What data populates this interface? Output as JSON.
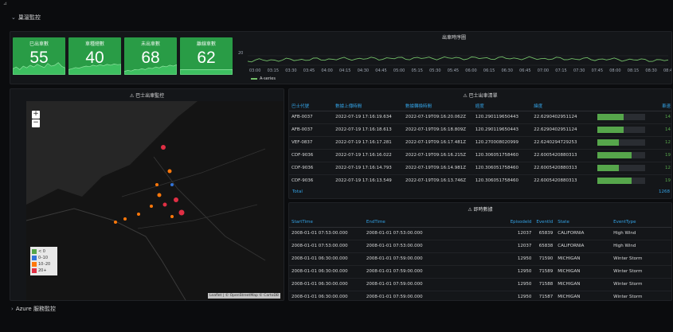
{
  "rows": {
    "first_title": "巢溫監控",
    "second_title": "Azure 服務監控"
  },
  "stats": [
    {
      "label": "巳出車數",
      "value": "55",
      "spark": [
        0.35,
        0.45,
        0.3,
        0.5,
        0.4,
        0.55,
        0.45,
        0.6,
        0.5,
        0.42,
        0.65,
        0.5,
        0.55,
        0.7,
        0.48,
        0.4
      ]
    },
    {
      "label": "車種總數",
      "value": "40",
      "spark": [
        0.3,
        0.35,
        0.42,
        0.38,
        0.45,
        0.5,
        0.47,
        0.55,
        0.5,
        0.58,
        0.52,
        0.6,
        0.55,
        0.62,
        0.58,
        0.6
      ]
    },
    {
      "label": "未出車數",
      "value": "68",
      "spark": [
        0.2,
        0.25,
        0.22,
        0.3,
        0.28,
        0.35,
        0.3,
        0.4,
        0.36,
        0.45,
        0.4,
        0.5,
        0.46,
        0.55,
        0.5,
        0.58
      ]
    },
    {
      "label": "離線車數",
      "value": "62",
      "spark": [
        0.3,
        0.3,
        0.3,
        0.3,
        0.3,
        0.3,
        0.3,
        0.3,
        0.3,
        0.3,
        0.3,
        0.3,
        0.3,
        0.3,
        0.3,
        0.3
      ]
    }
  ],
  "timeseries": {
    "title": "出車時序圖",
    "y_tick": "20",
    "x_ticks": [
      "03:00",
      "03:15",
      "03:30",
      "03:45",
      "04:00",
      "04:15",
      "04:30",
      "04:45",
      "05:00",
      "05:15",
      "05:30",
      "05:45",
      "06:00",
      "06:15",
      "06:30",
      "06:45",
      "07:00",
      "07:15",
      "07:30",
      "07:45",
      "08:00",
      "08:15",
      "08:30",
      "08:45"
    ],
    "legend": "A-series",
    "color": "#73bf69"
  },
  "map_panel": {
    "title": "巴士出車監控",
    "zoom_in": "+",
    "zoom_out": "−",
    "legend": [
      {
        "label": "< 0",
        "color": "#56a64b"
      },
      {
        "label": "0–10",
        "color": "#3274d9"
      },
      {
        "label": "10–20",
        "color": "#ff780a"
      },
      {
        "label": "20+",
        "color": "#e02f44"
      }
    ],
    "attribution": "Leaflet | © OpenStreetMap © CartoDB"
  },
  "bus_table": {
    "title": "巴士出車清單",
    "columns": [
      "巴士代號",
      "數據上傳時間",
      "數據轉換時間",
      "經度",
      "緯度",
      "",
      "車速"
    ],
    "rows": [
      {
        "id": "AFB-0037",
        "upload": "2022-07-19 17:16:19.634",
        "convert": "2022-07-19T09:16:20.062Z",
        "lon": "120.290119650443",
        "lat": "22.6290402951124",
        "gauge": 0.55,
        "speed": "14"
      },
      {
        "id": "AFB-0037",
        "upload": "2022-07-19 17:16:18.613",
        "convert": "2022-07-19T09:16:18.809Z",
        "lon": "120.290119650443",
        "lat": "22.6290402951124",
        "gauge": 0.55,
        "speed": "14"
      },
      {
        "id": "VEF-0837",
        "upload": "2022-07-19 17:16:17.281",
        "convert": "2022-07-19T09:16:17.481Z",
        "lon": "120.270008020999",
        "lat": "22.6240294729253",
        "gauge": 0.45,
        "speed": "12"
      },
      {
        "id": "CDF-9036",
        "upload": "2022-07-19 17:16:16.022",
        "convert": "2022-07-19T09:16:16.215Z",
        "lon": "120.306051758460",
        "lat": "22.6005420880313",
        "gauge": 0.72,
        "speed": "19"
      },
      {
        "id": "CDF-9036",
        "upload": "2022-07-19 17:16:14.793",
        "convert": "2022-07-19T09:16:14.981Z",
        "lon": "120.306051758460",
        "lat": "22.6005420880313",
        "gauge": 0.45,
        "speed": "12"
      },
      {
        "id": "CDF-9036",
        "upload": "2022-07-19 17:16:13.549",
        "convert": "2022-07-19T09:16:13.746Z",
        "lon": "120.306051758460",
        "lat": "22.6005420880313",
        "gauge": 0.72,
        "speed": "19"
      }
    ],
    "total_label": "Total",
    "total_value": "1268"
  },
  "event_table": {
    "title": "即時數據",
    "columns": [
      "StartTime",
      "EndTime",
      "EpisodeId",
      "EventId",
      "State",
      "EventType"
    ],
    "rows": [
      {
        "start": "2008-01-01 07:53:00.000",
        "end": "2008-01-01 07:53:00.000",
        "episode": "12037",
        "event": "65839",
        "state": "CALIFORNIA",
        "type": "High Wind"
      },
      {
        "start": "2008-01-01 07:53:00.000",
        "end": "2008-01-01 07:53:00.000",
        "episode": "12037",
        "event": "65838",
        "state": "CALIFORNIA",
        "type": "High Wind"
      },
      {
        "start": "2008-01-01 06:30:00.000",
        "end": "2008-01-01 07:59:00.000",
        "episode": "12950",
        "event": "71590",
        "state": "MICHIGAN",
        "type": "Winter Storm"
      },
      {
        "start": "2008-01-01 06:30:00.000",
        "end": "2008-01-01 07:59:00.000",
        "episode": "12950",
        "event": "71589",
        "state": "MICHIGAN",
        "type": "Winter Storm"
      },
      {
        "start": "2008-01-01 06:30:00.000",
        "end": "2008-01-01 07:59:00.000",
        "episode": "12950",
        "event": "71588",
        "state": "MICHIGAN",
        "type": "Winter Storm"
      },
      {
        "start": "2008-01-01 06:30:00.000",
        "end": "2008-01-01 07:59:00.000",
        "episode": "12950",
        "event": "71587",
        "state": "MICHIGAN",
        "type": "Winter Storm"
      }
    ]
  },
  "colors": {
    "accent_green": "#299c46",
    "header_blue": "#33a2e5"
  }
}
